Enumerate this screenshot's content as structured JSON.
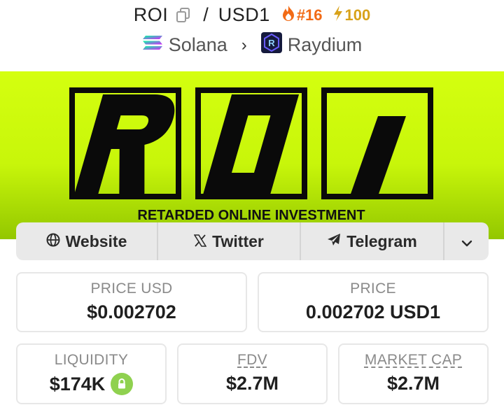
{
  "header": {
    "symbol": "ROI",
    "slash": "/",
    "quote": "USD1",
    "rank": "#16",
    "boosts": "100",
    "chain": "Solana",
    "dex": "Raydium"
  },
  "banner": {
    "logo_text": "ROI",
    "tagline": "RETARDED ONLINE INVESTMENT",
    "background": "#d4ff0f"
  },
  "links": {
    "website": "Website",
    "twitter": "Twitter",
    "telegram": "Telegram"
  },
  "stats": {
    "price_usd_label": "PRICE USD",
    "price_usd_value": "$0.002702",
    "price_label": "PRICE",
    "price_value": "0.002702 USD1",
    "liquidity_label": "LIQUIDITY",
    "liquidity_value": "$174K",
    "fdv_label": "FDV",
    "fdv_value": "$2.7M",
    "mcap_label": "MARKET CAP",
    "mcap_value": "$2.7M"
  },
  "colors": {
    "rank": "#f26b16",
    "boost": "#d8a21a",
    "lock": "#8fd14f"
  }
}
